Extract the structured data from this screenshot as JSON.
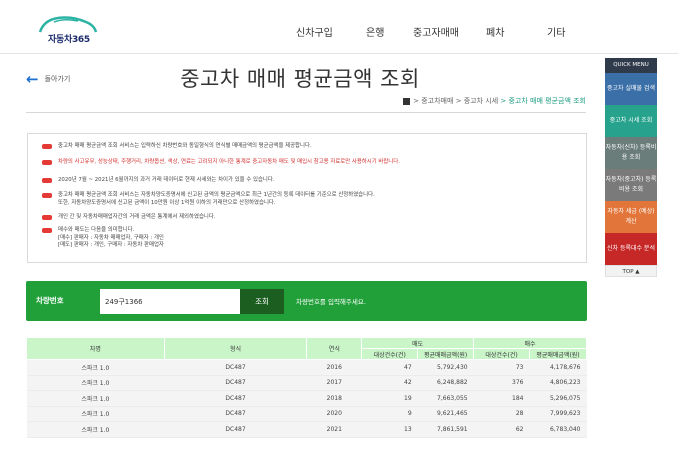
{
  "header": {
    "logo_text": "자동차365",
    "nav": [
      "신차구입",
      "은행",
      "중고자매매",
      "폐차",
      "기타"
    ]
  },
  "page": {
    "back_label": "돌아가기",
    "title": "중고차 매매 평균금액 조회",
    "breadcrumb": [
      "> 중고차매매",
      "> 중고차 시세",
      "> 중고차 매매 평균금액 조회"
    ]
  },
  "quick_menu": {
    "head": "QUICK MENU",
    "items": [
      {
        "label": "중고차 실매물 검색",
        "color": "#3b6fa8"
      },
      {
        "label": "중고차 시세 조회",
        "color": "#27a38d"
      },
      {
        "label": "자동차(신차) 등록비용 조회",
        "color": "#6b7d7b"
      },
      {
        "label": "자동차(중고차) 등록비용 조회",
        "color": "#7a7a7a"
      },
      {
        "label": "자동차 세금 (예상) 계산",
        "color": "#e2763a"
      },
      {
        "label": "신차 등록대수 분석",
        "color": "#c62828"
      }
    ],
    "top": "TOP ▲"
  },
  "notices": [
    "중고차 매매 평균금액 조회 서비스는 입력하신 차량번호와 동일형식의 연식별 매매금액의 평균금액을 제공합니다.",
    "차량의 사고유무, 성능상태, 주행거리, 차량옵션, 색상, 연료는 고려되지 아니한 통계로 중고자동차 매도 및 매입시 참고용 자료로만 사용하시기 바랍니다.",
    "2020년 7월 ~ 2021년 6월까지의 과거 거래 데이터로 현재 시세와는 차이가 있을 수 있습니다.",
    "중고차 매매 평균금액 조회 서비스는 자동차양도증명서에 신고된 금액의 평균금액으로 최근 1년간의 등록 데이터를 기준으로 산정하였습니다.",
    "또한, 자동차양도증명서에 신고된 금액이 10만원 이상 1억원 이하의 거래만으로 산정하였습니다.",
    "개인 간 및 자동차매매업자간의 거래 금액은 통계에서 제외하였습니다.",
    "매수와 매도는 다음을 의미합니다.",
    "[매수] 판매자 : 자동차 매매업자, 구매자 : 개인",
    "[매도] 판매자 : 개인, 구매자 : 자동차 판매업자"
  ],
  "search": {
    "label": "차량번호",
    "value": "249구1366",
    "button": "조회",
    "hint": "차량번호를 입력해주세요."
  },
  "table": {
    "headers": {
      "model": "차명",
      "type": "형식",
      "year": "연식",
      "sell": "매도",
      "buy": "매수",
      "count": "대상건수(건)",
      "avg": "평균매매금액(원)"
    },
    "rows": [
      [
        "스파크 1.0",
        "DC487",
        "2016",
        "47",
        "5,792,430",
        "73",
        "4,178,676"
      ],
      [
        "스파크 1.0",
        "DC487",
        "2017",
        "42",
        "6,248,882",
        "376",
        "4,806,223"
      ],
      [
        "스파크 1.0",
        "DC487",
        "2018",
        "19",
        "7,663,055",
        "184",
        "5,296,075"
      ],
      [
        "스파크 1.0",
        "DC487",
        "2020",
        "9",
        "9,621,465",
        "28",
        "7,999,623"
      ],
      [
        "스파크 1.0",
        "DC487",
        "2021",
        "13",
        "7,861,591",
        "62",
        "6,783,040"
      ]
    ]
  }
}
